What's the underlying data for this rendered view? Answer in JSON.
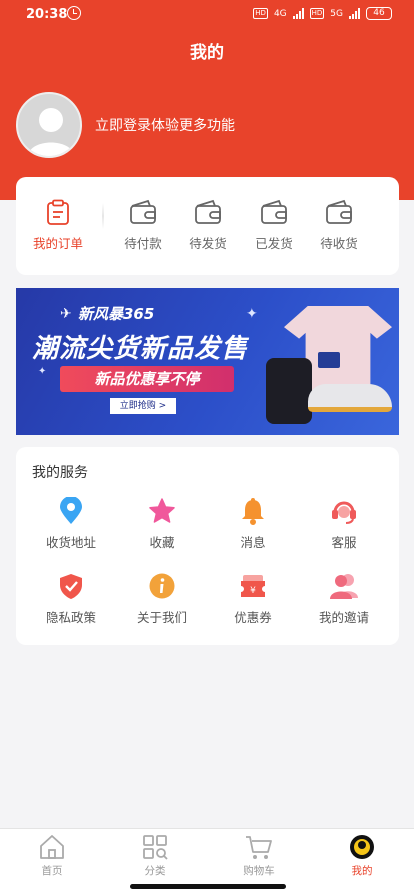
{
  "status_bar": {
    "time": "20:38",
    "battery": "46",
    "net1": "4G",
    "net2": "5G"
  },
  "header": {
    "title": "我的",
    "login_prompt": "立即登录体验更多功能"
  },
  "orders": [
    {
      "label": "我的订单",
      "icon": "clipboard-icon",
      "active": true
    },
    {
      "label": "待付款",
      "icon": "wallet-icon"
    },
    {
      "label": "待发货",
      "icon": "wallet-icon"
    },
    {
      "label": "已发货",
      "icon": "wallet-icon"
    },
    {
      "label": "待收货",
      "icon": "wallet-icon"
    }
  ],
  "banner": {
    "brand": "新风暴365",
    "headline": "潮流尖货新品发售",
    "subline": "新品优惠享不停",
    "button": "立即抢购 >"
  },
  "services": {
    "title": "我的服务",
    "items": [
      {
        "label": "收货地址",
        "icon": "location-pin-icon",
        "color": "#3aa5f3"
      },
      {
        "label": "收藏",
        "icon": "star-icon",
        "color": "#f0589b"
      },
      {
        "label": "消息",
        "icon": "bell-icon",
        "color": "#f5922f"
      },
      {
        "label": "客服",
        "icon": "headset-icon",
        "color": "#ef5a5a"
      },
      {
        "label": "隐私政策",
        "icon": "shield-icon",
        "color": "#f0564b"
      },
      {
        "label": "关于我们",
        "icon": "info-icon",
        "color": "#f2a23a"
      },
      {
        "label": "优惠券",
        "icon": "coupon-icon",
        "color": "#f0564b"
      },
      {
        "label": "我的邀请",
        "icon": "users-icon",
        "color": "#ef6a7d"
      }
    ]
  },
  "tabbar": [
    {
      "label": "首页",
      "icon": "home-icon"
    },
    {
      "label": "分类",
      "icon": "category-icon"
    },
    {
      "label": "购物车",
      "icon": "cart-icon"
    },
    {
      "label": "我的",
      "icon": "profile-icon",
      "active": true
    }
  ],
  "colors": {
    "brand": "#e8432b",
    "background": "#f4f4f6"
  }
}
